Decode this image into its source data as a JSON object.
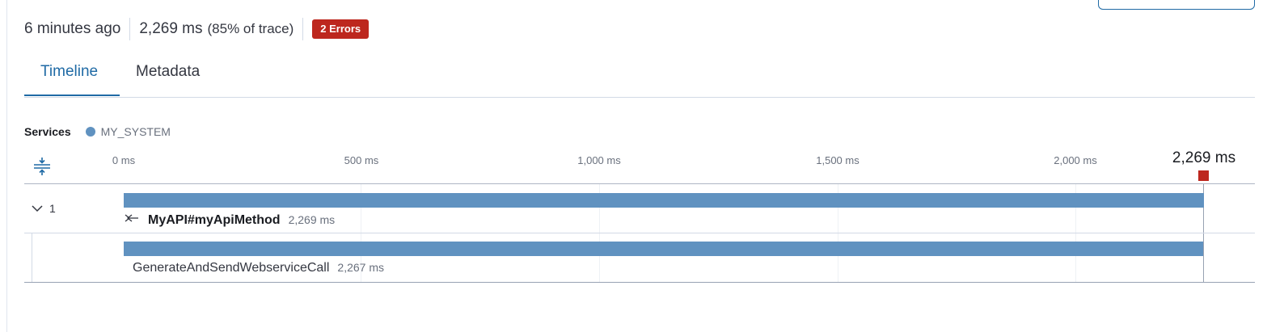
{
  "summary": {
    "time_ago": "6 minutes ago",
    "duration": "2,269 ms",
    "percent_of_trace": "(85% of trace)",
    "errors_badge": "2 Errors"
  },
  "tabs": [
    {
      "label": "Timeline",
      "active": true
    },
    {
      "label": "Metadata",
      "active": false
    }
  ],
  "services": {
    "label": "Services",
    "items": [
      {
        "name": "MY_SYSTEM",
        "color": "#6092c0"
      }
    ]
  },
  "timeline": {
    "ticks": [
      "0 ms",
      "500 ms",
      "1,000 ms",
      "1,500 ms",
      "2,000 ms"
    ],
    "end_label": "2,269 ms",
    "error_marker_color": "#bd271e",
    "group": {
      "expand_count": "1"
    },
    "spans": [
      {
        "name": "MyAPI#myApiMethod",
        "duration": "2,269 ms",
        "duration_ms": 2269,
        "bold": true,
        "icon": "incoming-arrows-icon"
      },
      {
        "name": "GenerateAndSendWebserviceCall",
        "duration": "2,267 ms",
        "duration_ms": 2267,
        "bold": false
      }
    ]
  },
  "colors": {
    "accent": "#1f6aa5",
    "bar": "#6092c0",
    "error": "#bd271e"
  }
}
